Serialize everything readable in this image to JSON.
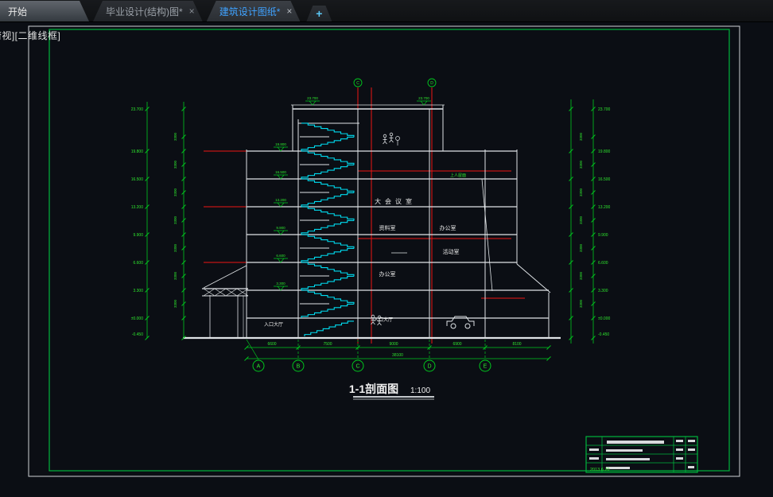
{
  "tab_bar": {
    "tabs": [
      {
        "label": "开始",
        "active": false,
        "closable": false
      },
      {
        "label": "毕业设计(结构)图*",
        "active": false,
        "closable": true
      },
      {
        "label": "建筑设计图纸*",
        "active": true,
        "closable": true
      }
    ],
    "new_tab_label": "+",
    "close_glyph": "×"
  },
  "viewport_label": "[俯视][二维线框]",
  "section": {
    "title": "1-1剖面图",
    "scale": "1:100",
    "axis_labels": [
      "A",
      "B",
      "C",
      "D",
      "E"
    ],
    "top_axis_labels": [
      "C",
      "D"
    ],
    "bottom_dims": [
      "6600",
      "7500",
      "9000",
      "6900",
      "8100"
    ],
    "bottom_total": "38100",
    "storey_dim": "3300",
    "left_elevations": [
      "23.700",
      "19.800",
      "16.500",
      "13.200",
      "9.900",
      "6.600",
      "3.300",
      "±0.000",
      "-0.450"
    ],
    "right_elevations": [
      "23.700",
      "19.800",
      "16.500",
      "13.200",
      "9.900",
      "6.600",
      "3.300",
      "±0.000",
      "-0.450"
    ],
    "inner_elevations": [
      "19.800",
      "16.500",
      "13.200",
      "9.900",
      "6.600",
      "3.300"
    ],
    "roof_elevation": "23.700",
    "roof_label": "上人屋面",
    "rooms": [
      {
        "name": "大会议室"
      },
      {
        "name": "资料室"
      },
      {
        "name": "办公室"
      },
      {
        "name": "办公室"
      },
      {
        "name": "活动室"
      },
      {
        "name": "入口大厅"
      },
      {
        "name": "入口大厅"
      }
    ],
    "symbols": [
      "stair-symbol",
      "car-symbol",
      "person-symbol",
      "plant-symbol"
    ]
  },
  "title_block": {
    "date": "2013.6.20"
  },
  "colors": {
    "canvas_bg": "#0b0e14",
    "line_white": "#dfe3e6",
    "line_red": "#ee1515",
    "line_green": "#00c81e",
    "text_green": "#2ee62e",
    "line_cyan": "#00dcf0",
    "frame_green": "#00b43c",
    "active_tab_text": "#3fa2ff"
  }
}
